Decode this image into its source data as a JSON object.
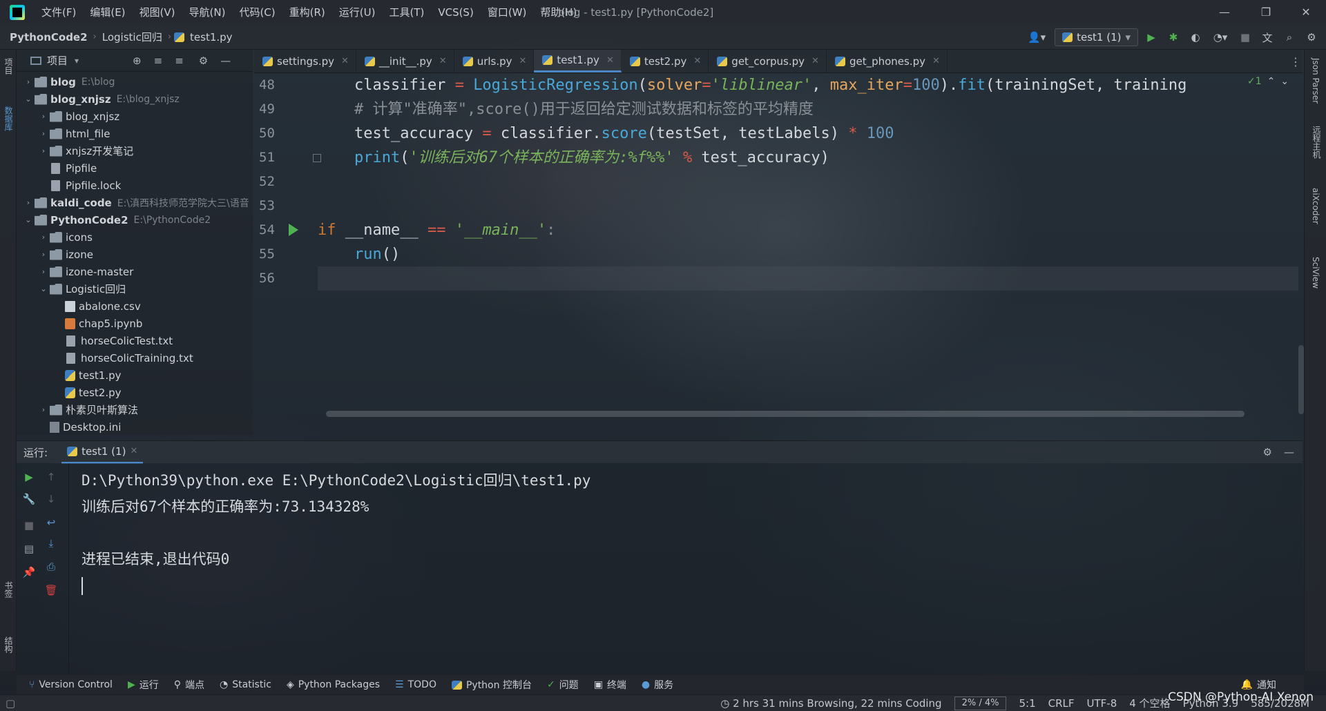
{
  "window": {
    "title": "blog - test1.py [PythonCode2]",
    "menu": [
      "文件(F)",
      "编辑(E)",
      "视图(V)",
      "导航(N)",
      "代码(C)",
      "重构(R)",
      "运行(U)",
      "工具(T)",
      "VCS(S)",
      "窗口(W)",
      "帮助(H)"
    ]
  },
  "breadcrumb": [
    "PythonCode2",
    "Logistic回归",
    "test1.py"
  ],
  "run_config": "test1 (1)",
  "left_stripe": {
    "project": "项目",
    "db": "数据库",
    "bookmarks": "书签",
    "structure": "结构"
  },
  "right_stripe": {
    "json": "Json Parser",
    "remote": "远程主机",
    "sciview": "SciView",
    "codewithme": "aiXcoder"
  },
  "project": {
    "title": "项目",
    "tree": [
      {
        "arrow": "›",
        "kind": "folder",
        "name": "blog",
        "hint": "E:\\blog",
        "bold": true,
        "indent": 0
      },
      {
        "arrow": "⌄",
        "kind": "folder",
        "name": "blog_xnjsz",
        "hint": "E:\\blog_xnjsz",
        "bold": true,
        "indent": 0
      },
      {
        "arrow": "›",
        "kind": "folder",
        "name": "blog_xnjsz",
        "hint": "",
        "bold": false,
        "indent": 1
      },
      {
        "arrow": "›",
        "kind": "folder",
        "name": "html_file",
        "hint": "",
        "bold": false,
        "indent": 1
      },
      {
        "arrow": "›",
        "kind": "folder",
        "name": "xnjsz开发笔记",
        "hint": "",
        "bold": false,
        "indent": 1
      },
      {
        "arrow": "",
        "kind": "file",
        "name": "Pipfile",
        "hint": "",
        "bold": false,
        "indent": 1
      },
      {
        "arrow": "",
        "kind": "file",
        "name": "Pipfile.lock",
        "hint": "",
        "bold": false,
        "indent": 1
      },
      {
        "arrow": "›",
        "kind": "folder",
        "name": "kaldi_code",
        "hint": "E:\\滇西科技师范学院大三\\语音",
        "bold": true,
        "indent": 0
      },
      {
        "arrow": "⌄",
        "kind": "folder",
        "name": "PythonCode2",
        "hint": "E:\\PythonCode2",
        "bold": true,
        "indent": 0
      },
      {
        "arrow": "›",
        "kind": "folder",
        "name": "icons",
        "hint": "",
        "bold": false,
        "indent": 1
      },
      {
        "arrow": "›",
        "kind": "folder",
        "name": "izone",
        "hint": "",
        "bold": false,
        "indent": 1
      },
      {
        "arrow": "›",
        "kind": "folder",
        "name": "izone-master",
        "hint": "",
        "bold": false,
        "indent": 1
      },
      {
        "arrow": "⌄",
        "kind": "folder",
        "name": "Logistic回归",
        "hint": "",
        "bold": false,
        "indent": 1
      },
      {
        "arrow": "",
        "kind": "csv",
        "name": "abalone.csv",
        "hint": "",
        "bold": false,
        "indent": 2
      },
      {
        "arrow": "",
        "kind": "nb",
        "name": "chap5.ipynb",
        "hint": "",
        "bold": false,
        "indent": 2
      },
      {
        "arrow": "",
        "kind": "file",
        "name": "horseColicTest.txt",
        "hint": "",
        "bold": false,
        "indent": 2
      },
      {
        "arrow": "",
        "kind": "file",
        "name": "horseColicTraining.txt",
        "hint": "",
        "bold": false,
        "indent": 2
      },
      {
        "arrow": "",
        "kind": "py",
        "name": "test1.py",
        "hint": "",
        "bold": false,
        "indent": 2
      },
      {
        "arrow": "",
        "kind": "py",
        "name": "test2.py",
        "hint": "",
        "bold": false,
        "indent": 2
      },
      {
        "arrow": "›",
        "kind": "folder",
        "name": "朴素贝叶斯算法",
        "hint": "",
        "bold": false,
        "indent": 1
      },
      {
        "arrow": "",
        "kind": "ini",
        "name": "Desktop.ini",
        "hint": "",
        "bold": false,
        "indent": 1
      }
    ]
  },
  "tabs": [
    {
      "label": "settings.py",
      "active": false
    },
    {
      "label": "__init__.py",
      "active": false
    },
    {
      "label": "urls.py",
      "active": false
    },
    {
      "label": "test1.py",
      "active": true
    },
    {
      "label": "test2.py",
      "active": false
    },
    {
      "label": "get_corpus.py",
      "active": false
    },
    {
      "label": "get_phones.py",
      "active": false
    }
  ],
  "inspection": "✓1",
  "editor": {
    "line_numbers": [
      "48",
      "49",
      "50",
      "51",
      "52",
      "53",
      "54",
      "55",
      "56"
    ],
    "lines": [
      "    classifier = LogisticRegression(solver='liblinear', max_iter=100).fit(trainingSet, training",
      "    # 计算\"准确率\",score()用于返回给定测试数据和标签的平均精度",
      "    test_accuracy = classifier.score(testSet, testLabels) * 100",
      "    print('训练后对67个样本的正确率为:%f%%' % test_accuracy)",
      "",
      "",
      "if __name__ == '__main__':",
      "    run()",
      ""
    ]
  },
  "run_panel": {
    "label": "运行:",
    "tab": "test1 (1)",
    "output": [
      "D:\\Python39\\python.exe E:\\PythonCode2\\Logistic回归\\test1.py",
      "训练后对67个样本的正确率为:73.134328%",
      "",
      "进程已结束,退出代码0"
    ]
  },
  "bottom_tools": [
    "Version Control",
    "运行",
    "端点",
    "Statistic",
    "Python Packages",
    "TODO",
    "Python 控制台",
    "问题",
    "终端",
    "服务"
  ],
  "notifications": "通知",
  "status": {
    "time_tracking": "2 hrs 31 mins Browsing, 22 mins Coding",
    "progress": "2% / 4%",
    "position": "5:1",
    "line_sep": "CRLF",
    "encoding": "UTF-8",
    "indent": "4 个空格",
    "interpreter": "Python 3.9",
    "memory": "585/2028M"
  },
  "watermark": "CSDN @Python-AI Xenon"
}
